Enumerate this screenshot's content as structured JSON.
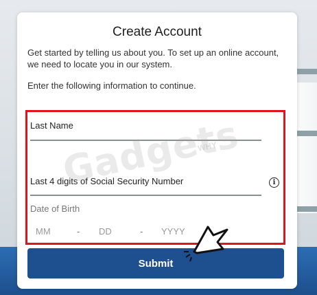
{
  "form": {
    "title": "Create Account",
    "intro": "Get started by telling us about you. To set up an online account, we need to locate you in our system.",
    "instruction": "Enter the following information to continue.",
    "last_name_label": "Last Name",
    "ssn_label": "Last 4 digits of Social Security Number",
    "dob_label": "Date of Birth",
    "dob_month_placeholder": "MM",
    "dob_day_placeholder": "DD",
    "dob_year_placeholder": "YYYY",
    "dob_separator": "-",
    "submit_label": "Submit"
  },
  "watermark": {
    "text": "Gadgets",
    "sub": "WHY"
  },
  "colors": {
    "highlight": "#e0151c",
    "primary_button": "#1e4f8f"
  },
  "icons": {
    "info": "info-icon",
    "cursor": "click-cursor-icon"
  }
}
